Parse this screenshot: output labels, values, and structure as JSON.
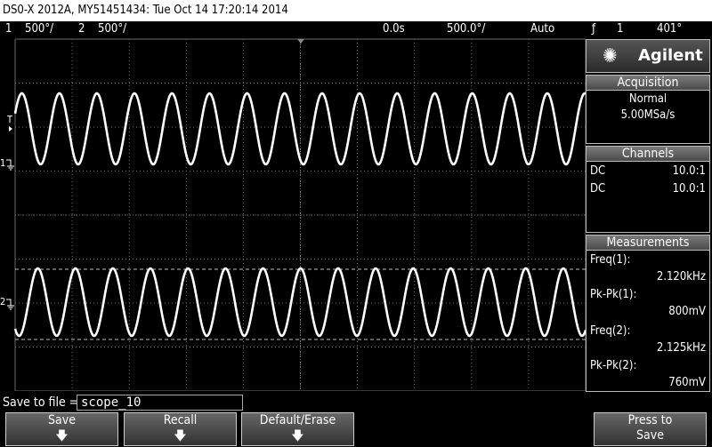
{
  "title": "DS0-X 2012A, MY51451434: Tue Oct 14 17:20:14 2014",
  "status": {
    "ch1_num": "1",
    "ch1_scale": "500°/",
    "ch2_num": "2",
    "ch2_scale": "500°/",
    "delay": "0.0s",
    "timebase": "500.0°/",
    "trigger_mode": "Auto",
    "trigger_icon": "ƒ",
    "trigger_channel": "1",
    "trigger_level": "401°"
  },
  "markers": {
    "trigger": "T",
    "ch1": "1",
    "ch2": "2"
  },
  "logo": "Agilent",
  "acquisition": {
    "header": "Acquisition",
    "mode": "Normal",
    "rate": "5.00MSa/s"
  },
  "channels": {
    "header": "Channels",
    "rows": [
      {
        "coupling": "DC",
        "probe": "10.0:1"
      },
      {
        "coupling": "DC",
        "probe": "10.0:1"
      }
    ]
  },
  "measurements": {
    "header": "Measurements",
    "items": [
      {
        "label": "Freq(1):",
        "value": "2.120kHz"
      },
      {
        "label": "Pk-Pk(1):",
        "value": "800mV"
      },
      {
        "label": "Freq(2):",
        "value": "2.125kHz"
      },
      {
        "label": "Pk-Pk(2):",
        "value": "760mV"
      }
    ]
  },
  "save": {
    "label": "Save to file =",
    "filename": "scope_10"
  },
  "softkeys": [
    "Save",
    "Recall",
    "Default/Erase"
  ],
  "press_to_save": [
    "Press to",
    "Save"
  ],
  "waveforms": {
    "ch1": {
      "cycles": 15.2
    },
    "ch2": {
      "cycles": 15.2
    }
  },
  "colors": {
    "trace": "#ffffff",
    "grid": "#6a6a6a"
  }
}
